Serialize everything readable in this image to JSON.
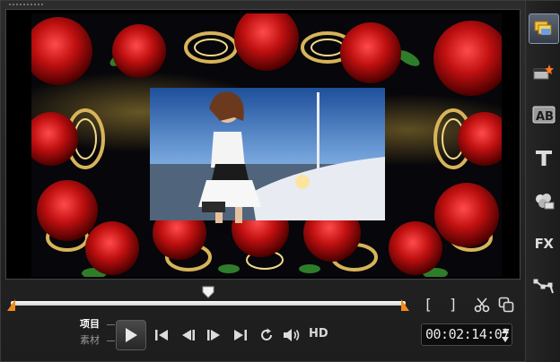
{
  "modes": {
    "project_label": "项目",
    "clip_label": "素材",
    "active": "project"
  },
  "playback": {
    "hd_label": "HD",
    "timecode": "00:02:14:07",
    "playhead_progress": 0.5,
    "trim_in_progress": 0.0,
    "trim_out_progress": 1.0
  },
  "marks": {
    "mark_in": "[",
    "mark_out": "]"
  },
  "sidebar": {
    "items": [
      {
        "name": "media",
        "icon": "media-library-icon",
        "active": true
      },
      {
        "name": "instant-project",
        "icon": "instant-project-icon",
        "active": false
      },
      {
        "name": "transition",
        "icon": "transition-icon",
        "active": false
      },
      {
        "name": "title",
        "icon": "title-icon",
        "active": false
      },
      {
        "name": "graphic",
        "icon": "graphic-icon",
        "active": false
      },
      {
        "name": "filter",
        "icon": "filter-icon",
        "label": "FX",
        "active": false
      },
      {
        "name": "path",
        "icon": "motion-path-icon",
        "active": false
      }
    ]
  },
  "colors": {
    "trim_marker": "#f08a1c",
    "track": "#ffffff",
    "accent_active": "#5d6675"
  },
  "preview": {
    "content": "video-frame"
  }
}
